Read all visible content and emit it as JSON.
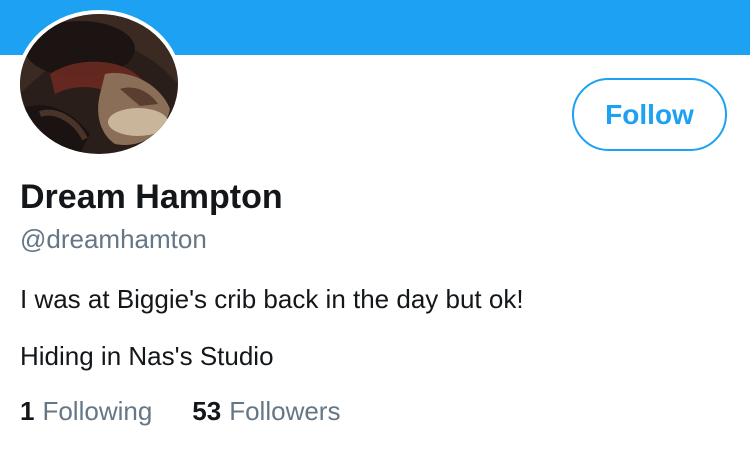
{
  "colors": {
    "accent": "#1da1f2",
    "text_primary": "#14171a",
    "text_secondary": "#657786"
  },
  "profile": {
    "name": "Dream Hampton",
    "handle": "@dreamhamton",
    "bio": "I was at Biggie's crib back in the day but ok!",
    "location": "Hiding in Nas's Studio",
    "avatar": "profile-photo"
  },
  "actions": {
    "follow_label": "Follow"
  },
  "stats": {
    "following_count": "1",
    "following_label": "Following",
    "followers_count": "53",
    "followers_label": "Followers"
  }
}
